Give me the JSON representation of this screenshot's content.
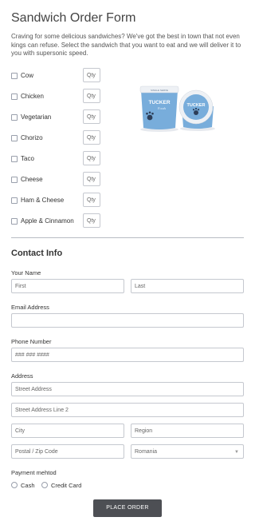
{
  "form": {
    "title": "Sandwich Order Form",
    "intro": "Craving for some delicious sandwiches? We've got the best in town that not even kings can refuse. Select the sandwich that you want to eat and we will deliver it to you with supersonic speed."
  },
  "products": [
    {
      "label": "Cow",
      "qty_placeholder": "Qty"
    },
    {
      "label": "Chicken",
      "qty_placeholder": "Qty"
    },
    {
      "label": "Vegetarian",
      "qty_placeholder": "Qty"
    },
    {
      "label": "Chorizo",
      "qty_placeholder": "Qty"
    },
    {
      "label": "Taco",
      "qty_placeholder": "Qty"
    },
    {
      "label": "Cheese",
      "qty_placeholder": "Qty"
    },
    {
      "label": "Ham & Cheese",
      "qty_placeholder": "Qty"
    },
    {
      "label": "Apple & Cinnamon",
      "qty_placeholder": "Qty"
    }
  ],
  "product_image": {
    "brand_text": "TUCKER",
    "sub_text": "Foods",
    "lid_text": "SINGLE SERVE",
    "brand_color": "#6fa8d9"
  },
  "contact": {
    "section_title": "Contact Info",
    "name_label": "Your Name",
    "first_placeholder": "First",
    "last_placeholder": "Last",
    "email_label": "Email Address",
    "phone_label": "Phone Number",
    "phone_placeholder": "### ### ####",
    "address_label": "Address",
    "street_placeholder": "Street Address",
    "street2_placeholder": "Street Address Line 2",
    "city_placeholder": "City",
    "region_placeholder": "Region",
    "postal_placeholder": "Postal / Zip Code",
    "country_value": "Romania"
  },
  "payment": {
    "label": "Payment mehtod",
    "options": [
      "Cash",
      "Credit Card"
    ]
  },
  "submit": {
    "label": "PLACE ORDER"
  }
}
